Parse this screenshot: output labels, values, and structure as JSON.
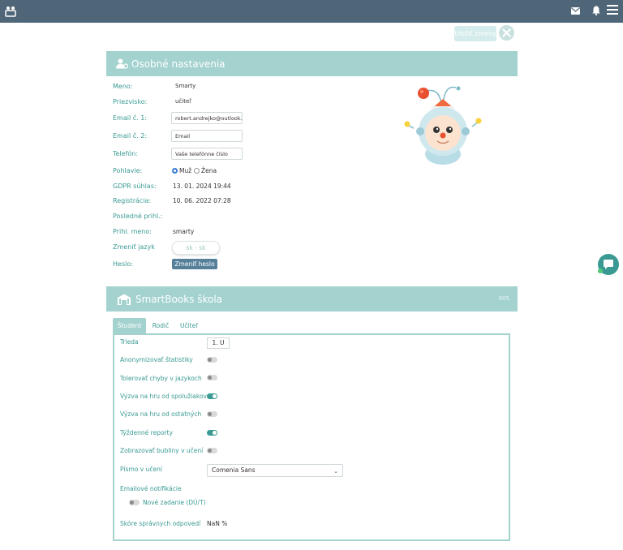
{
  "toolbar": {
    "save_label": "Uložiť zmeny"
  },
  "personal": {
    "title": "Osobné nastavenia",
    "fields": {
      "first_name_label": "Meno:",
      "first_name": "Smarty",
      "last_name_label": "Priezvisko:",
      "last_name": "učiteľ",
      "email1_label": "Email č. 1:",
      "email1_value": "robert.andrejko@outlook.com",
      "email2_label": "Email č. 2:",
      "email2_placeholder": "Email",
      "phone_label": "Telefón:",
      "phone_placeholder": "Vaše telefónne číslo",
      "gender_label": "Pohlavie:",
      "gender_male": "Muž",
      "gender_female": "Žena",
      "gdpr_label": "GDPR súhlas:",
      "gdpr_value": "13. 01. 2024 19:44",
      "registration_label": "Registrácia:",
      "registration_value": "10. 06. 2022 07:28",
      "last_login_label": "Posledné prihl.:",
      "login_name_label": "Prihl. meno:",
      "login_name": "smarty",
      "language_label": "Zmeniť jazyk",
      "language_value": "sk - sk",
      "password_label": "Heslo:",
      "password_button": "Zmeniť heslo"
    }
  },
  "school": {
    "title": "SmartBooks škola",
    "count": "905",
    "tabs": [
      {
        "label": "Študent"
      },
      {
        "label": "Rodič"
      },
      {
        "label": "Učiteľ"
      }
    ],
    "class_label": "Trieda",
    "class_value": "1. U",
    "settings": [
      {
        "label": "Anonymizovať štatistiky",
        "on": false
      },
      {
        "label": "Tolerovať chyby v jazykoch",
        "on": false
      },
      {
        "label": "Výzva na hru od spolužiakov",
        "on": true
      },
      {
        "label": "Výzva na hru od ostatných",
        "on": false
      },
      {
        "label": "Týždenné reporty",
        "on": true
      },
      {
        "label": "Zobrazovať bubliny v učení",
        "on": false
      }
    ],
    "font_label": "Písmo v učení",
    "font_value": "Comenia Sans",
    "email_notif_label": "Emailové notifikácie",
    "new_task_label": "Nové zadanie (DÚ/T)",
    "new_task_on": false,
    "score_label": "Skóre správnych odpovedí",
    "score_value": "NaN %"
  },
  "colors": {
    "topbar": "#4f6678",
    "accent": "#a3d2cf",
    "teal": "#3a9a93",
    "button": "#567f9a"
  }
}
